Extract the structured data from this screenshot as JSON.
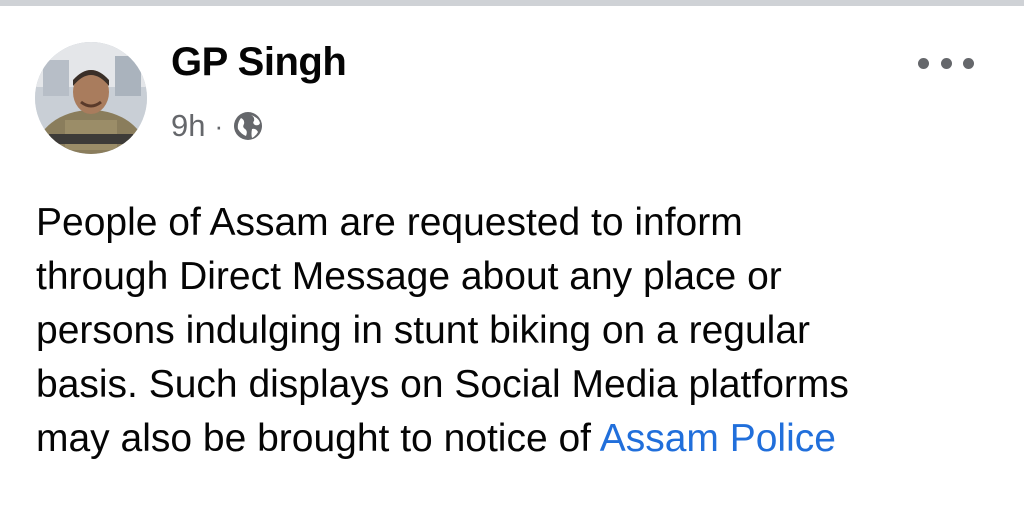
{
  "post": {
    "author": "GP Singh",
    "time": "9h",
    "separator": "·",
    "privacy_icon": "globe-icon",
    "more_icon": "more-options-icon",
    "text_lines": [
      "People of Assam are requested to inform",
      "through Direct Message about any place or",
      "persons indulging in stunt biking on a regular",
      "basis. Such displays on Social Media platforms",
      "may also be brought to notice of "
    ],
    "mention": "Assam Police"
  },
  "colors": {
    "link": "#216fdb",
    "text": "#050505",
    "secondary": "#65676b"
  }
}
